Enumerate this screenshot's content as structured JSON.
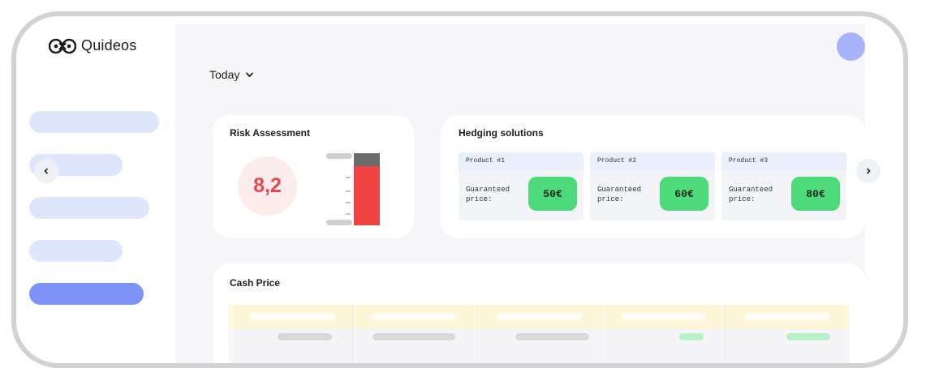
{
  "brand": {
    "name": "Quideos",
    "logo_icon": "infinity-logo-icon"
  },
  "header": {
    "period_label": "Today",
    "period_icon": "chevron-down-icon",
    "avatar": "user-avatar"
  },
  "sidebar": {
    "items": [
      "nav-item-1",
      "nav-item-2",
      "nav-item-3",
      "nav-item-4",
      "nav-item-5"
    ],
    "active_index": 4,
    "collapse_icon": "chevron-left-icon"
  },
  "risk": {
    "title": "Risk Assessment",
    "score": "8,2",
    "gauge_level": 0.82,
    "colors": {
      "high": "#ef4444",
      "cap": "#6b6b6b"
    }
  },
  "hedging": {
    "title": "Hedging solutions",
    "next_icon": "chevron-right-icon",
    "products": [
      {
        "name": "Product #1",
        "label": "Guaranteed price:",
        "price": "50€"
      },
      {
        "name": "Product #2",
        "label": "Guaranteed price:",
        "price": "60€"
      },
      {
        "name": "Product #3",
        "label": "Guaranteed price:",
        "price": "80€"
      }
    ]
  },
  "cash": {
    "title": "Cash Price",
    "columns": 5
  },
  "colors": {
    "accent": "#7e93f7",
    "price_green": "#4cda7b",
    "risk_red": "#e8484d"
  }
}
